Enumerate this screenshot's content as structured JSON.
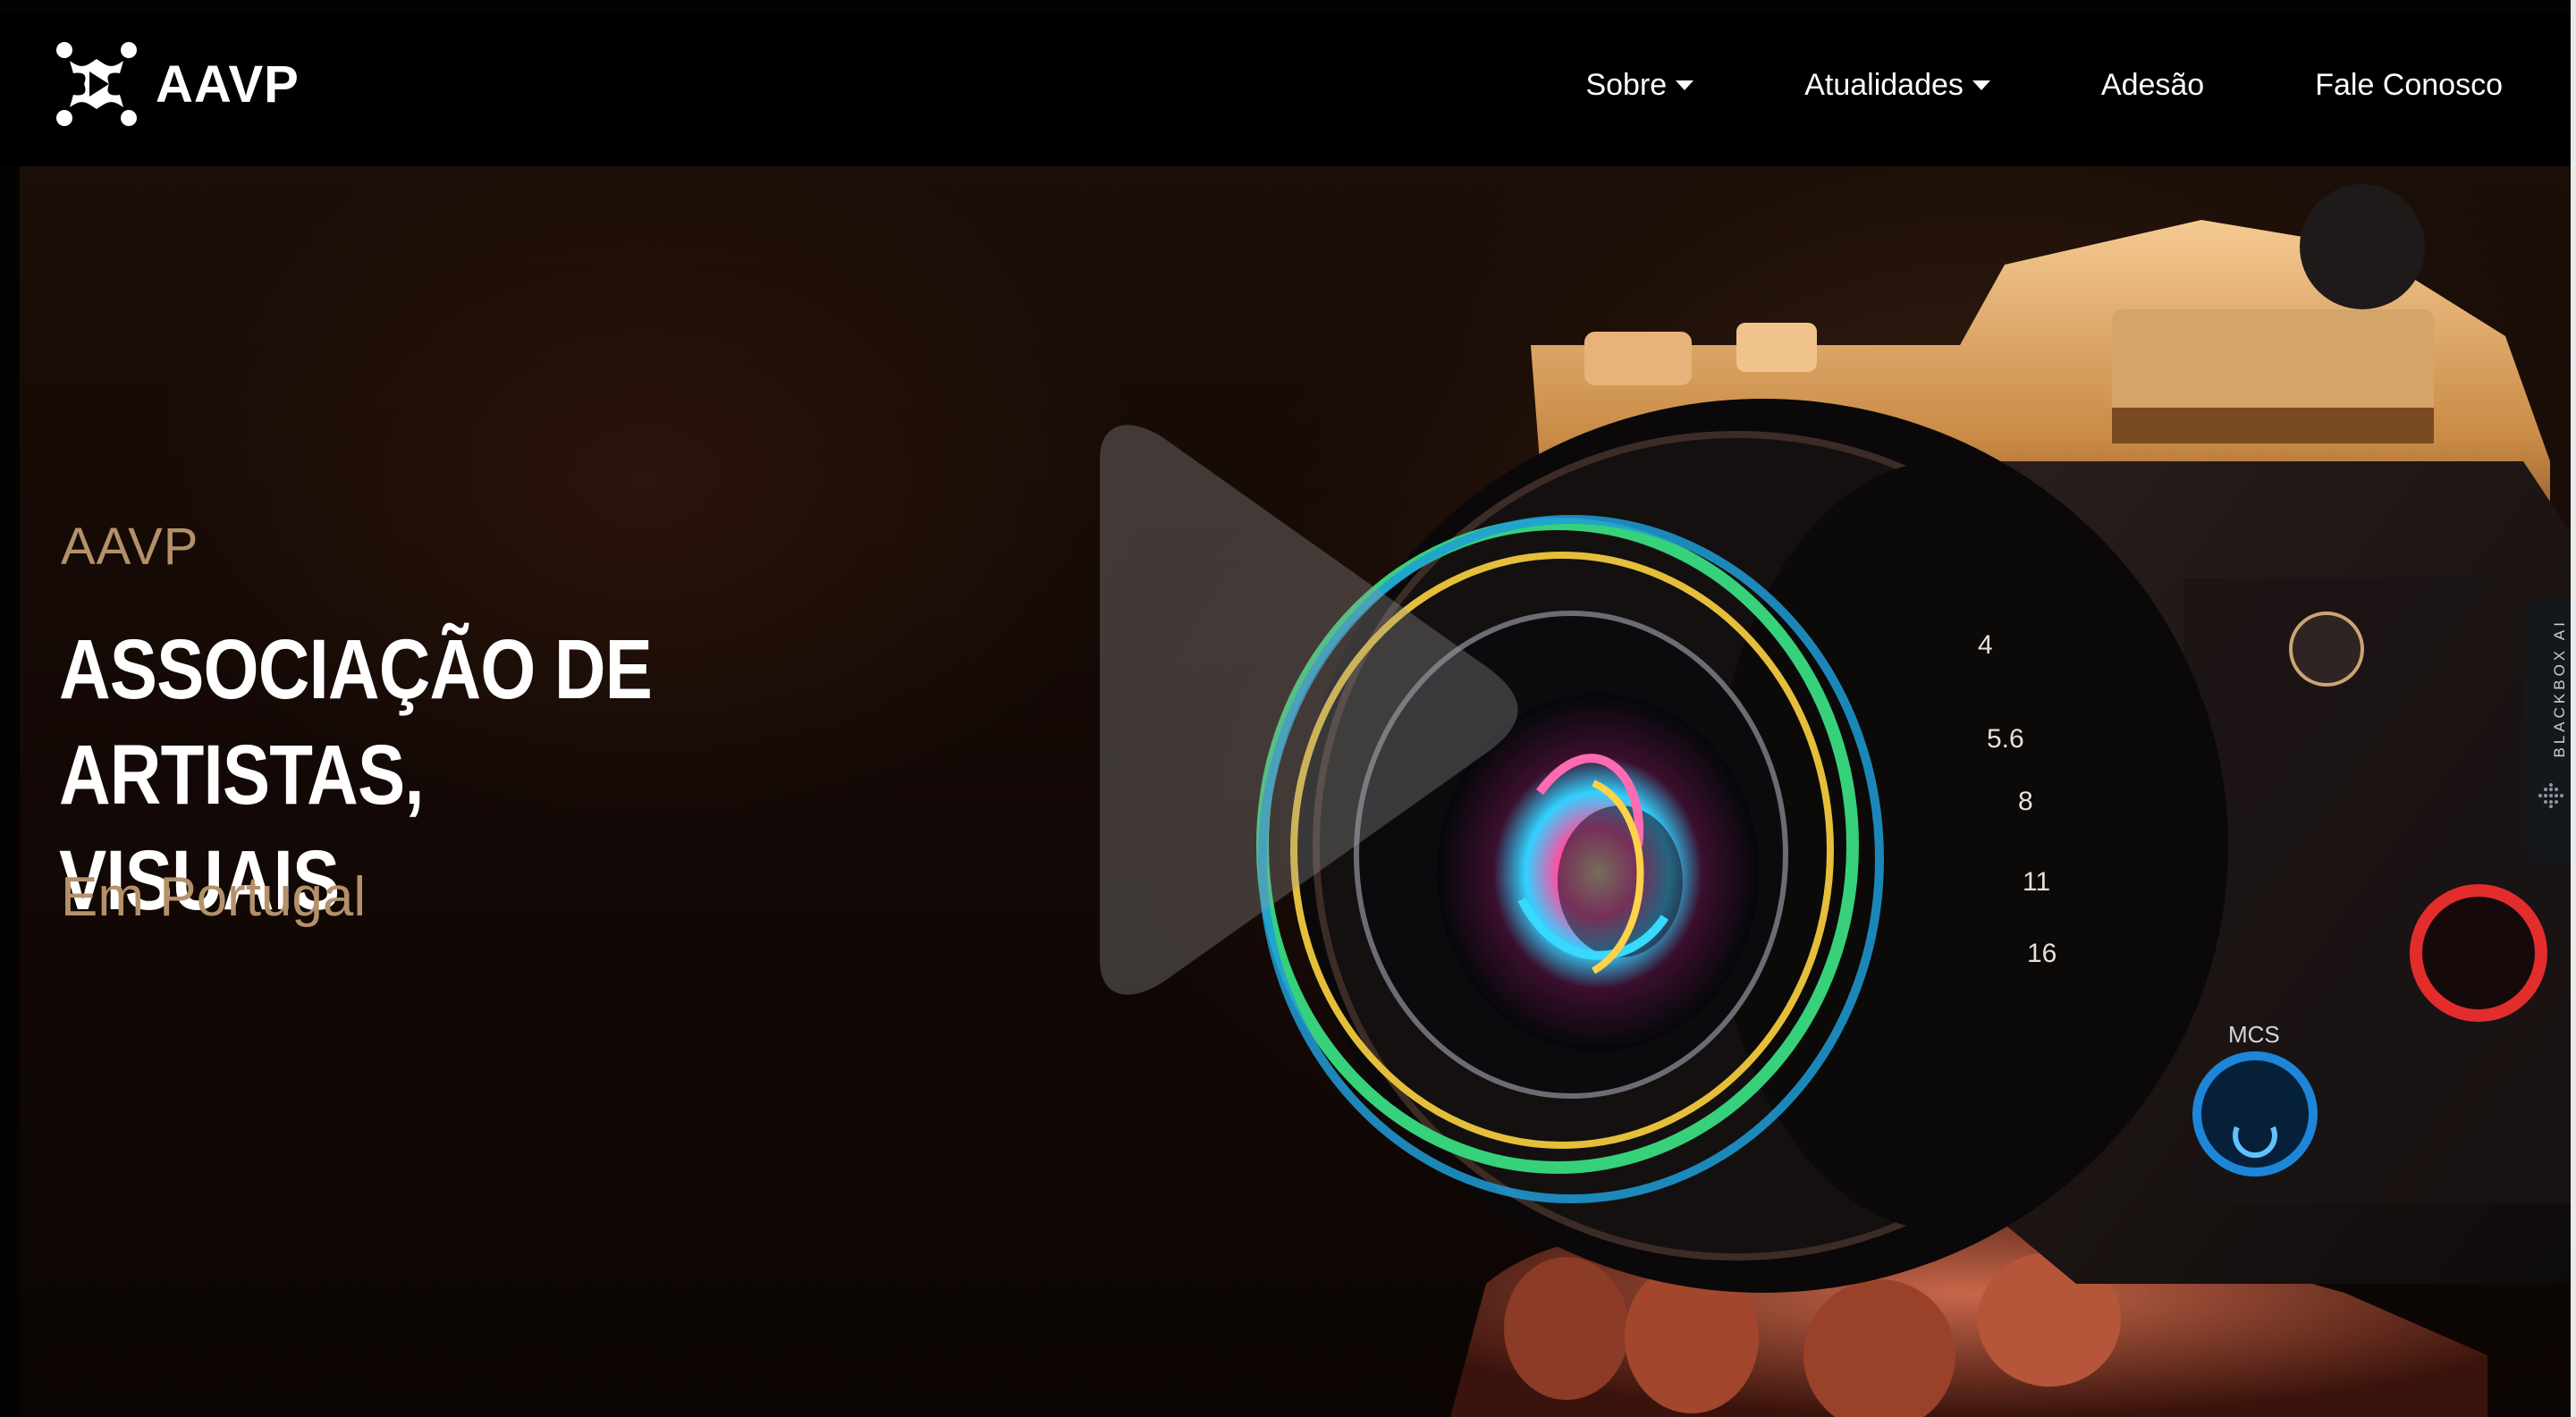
{
  "header": {
    "brand": "AAVP",
    "nav": [
      {
        "label": "Sobre",
        "has_dropdown": true
      },
      {
        "label": "Atualidades",
        "has_dropdown": true
      },
      {
        "label": "Adesão",
        "has_dropdown": false
      },
      {
        "label": "Fale Conosco",
        "has_dropdown": false
      }
    ]
  },
  "hero": {
    "eyebrow": "AAVP",
    "headline_line1": "ASSOCIAÇÃO DE ARTISTAS,",
    "headline_line2": "VISUAIS",
    "subline": "Em Portugal",
    "play_icon": "play-icon",
    "lens_markings": [
      "4",
      "5.6",
      "8",
      "11",
      "16"
    ],
    "button_label": "MCS"
  },
  "side_tab": {
    "label": "BLACKBOX AI",
    "icon": "dot-grid-icon"
  },
  "colors": {
    "header_bg": "#000000",
    "accent_tan": "#b49169",
    "headline": "#ffffff"
  }
}
